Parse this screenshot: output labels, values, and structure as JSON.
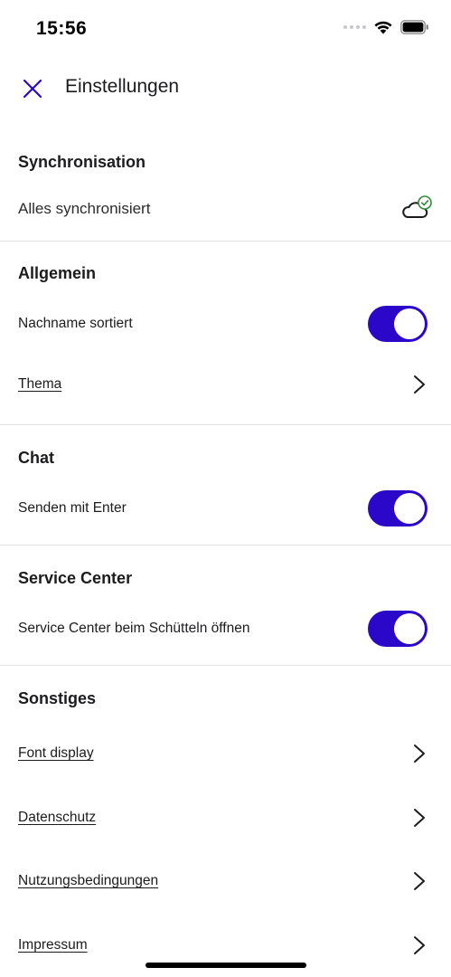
{
  "status_bar": {
    "time": "15:56"
  },
  "header": {
    "title": "Einstellungen",
    "close_icon": "close-icon"
  },
  "sync": {
    "title": "Synchronisation",
    "status": "Alles synchronisiert",
    "status_icon": "cloud-check-icon"
  },
  "general": {
    "title": "Allgemein",
    "sort_by_lastname": {
      "label": "Nachname sortiert",
      "enabled": true
    },
    "theme": {
      "label": "Thema"
    }
  },
  "chat": {
    "title": "Chat",
    "send_with_enter": {
      "label": "Senden mit Enter",
      "enabled": true
    }
  },
  "service_center": {
    "title": "Service Center",
    "shake_to_open": {
      "label": "Service Center beim Schütteln öffnen",
      "enabled": true
    }
  },
  "misc": {
    "title": "Sonstiges",
    "items": [
      {
        "label": "Font display"
      },
      {
        "label": "Datenschutz"
      },
      {
        "label": "Nutzungsbedingungen"
      },
      {
        "label": "Impressum"
      }
    ]
  },
  "colors": {
    "accent": "#2a07c9",
    "success": "#2e8b3a"
  }
}
